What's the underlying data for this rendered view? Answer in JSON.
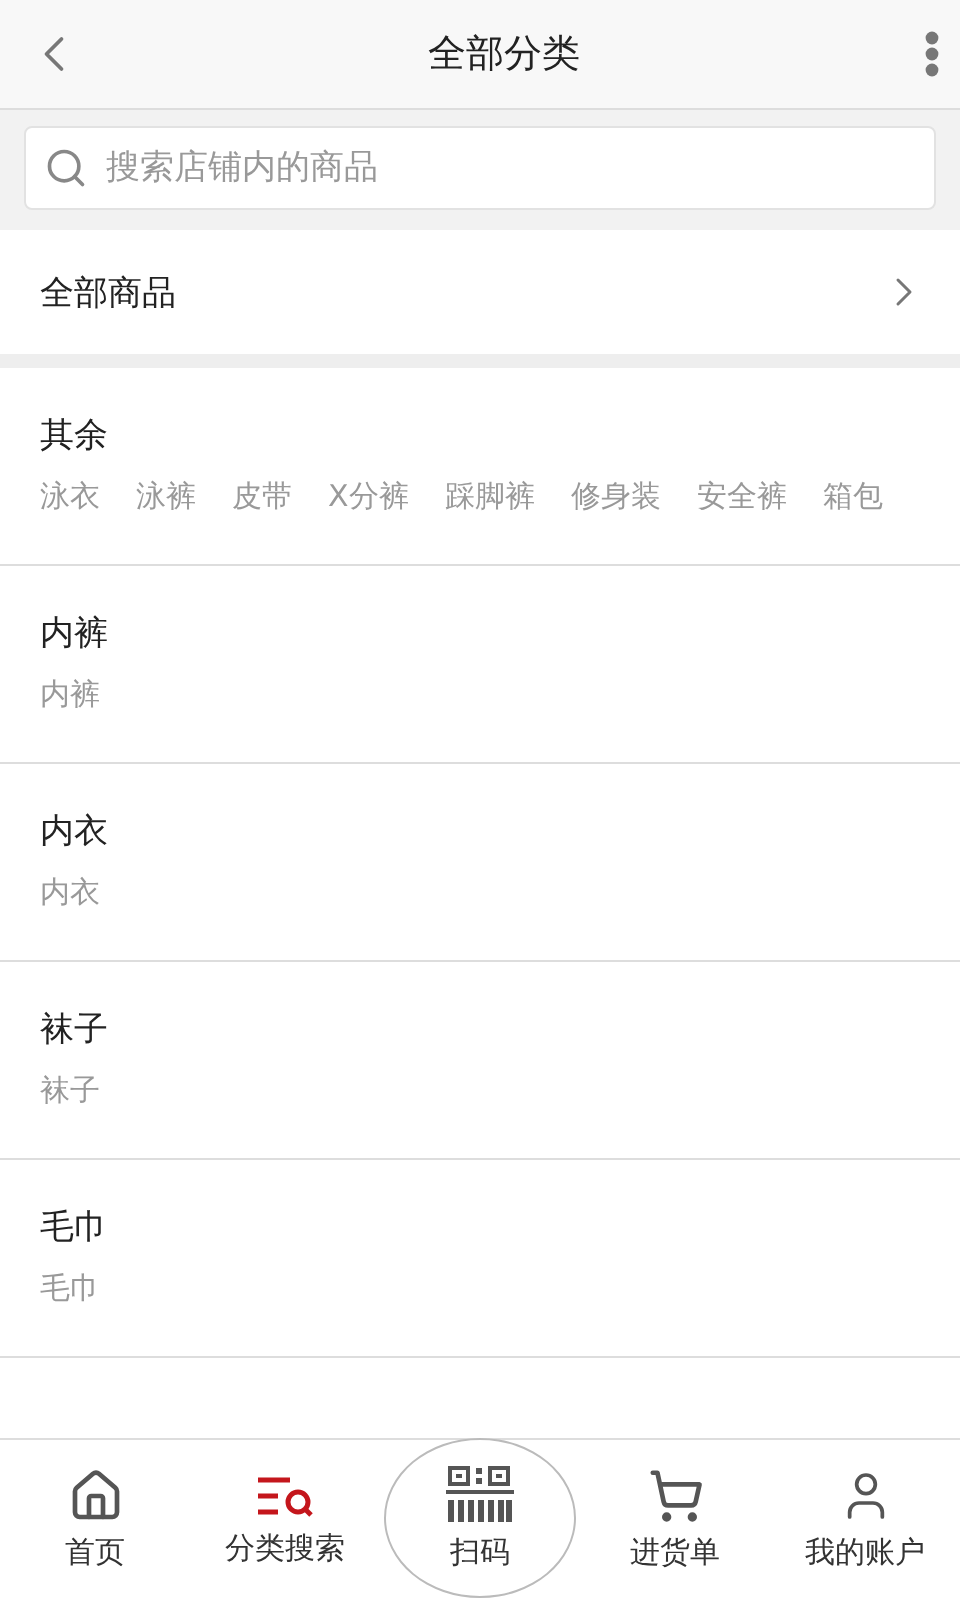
{
  "header": {
    "title": "全部分类"
  },
  "search": {
    "placeholder": "搜索店铺内的商品"
  },
  "all_goods": {
    "label": "全部商品"
  },
  "categories": [
    {
      "name": "其余",
      "subcategories": [
        "泳衣",
        "泳裤",
        "皮带",
        "X分裤",
        "踩脚裤",
        "修身装",
        "安全裤",
        "箱包"
      ]
    },
    {
      "name": "内裤",
      "subcategories": [
        "内裤"
      ]
    },
    {
      "name": "内衣",
      "subcategories": [
        "内衣"
      ]
    },
    {
      "name": "袜子",
      "subcategories": [
        "袜子"
      ]
    },
    {
      "name": "毛巾",
      "subcategories": [
        "毛巾"
      ]
    }
  ],
  "tab_bar": [
    {
      "kind": "home",
      "label": "首页",
      "selected": false
    },
    {
      "kind": "category",
      "label": "分类搜索",
      "selected": true
    },
    {
      "kind": "scan",
      "label": "扫码",
      "selected": false
    },
    {
      "kind": "cart",
      "label": "进货单",
      "selected": false
    },
    {
      "kind": "account",
      "label": "我的账户",
      "selected": false
    }
  ]
}
